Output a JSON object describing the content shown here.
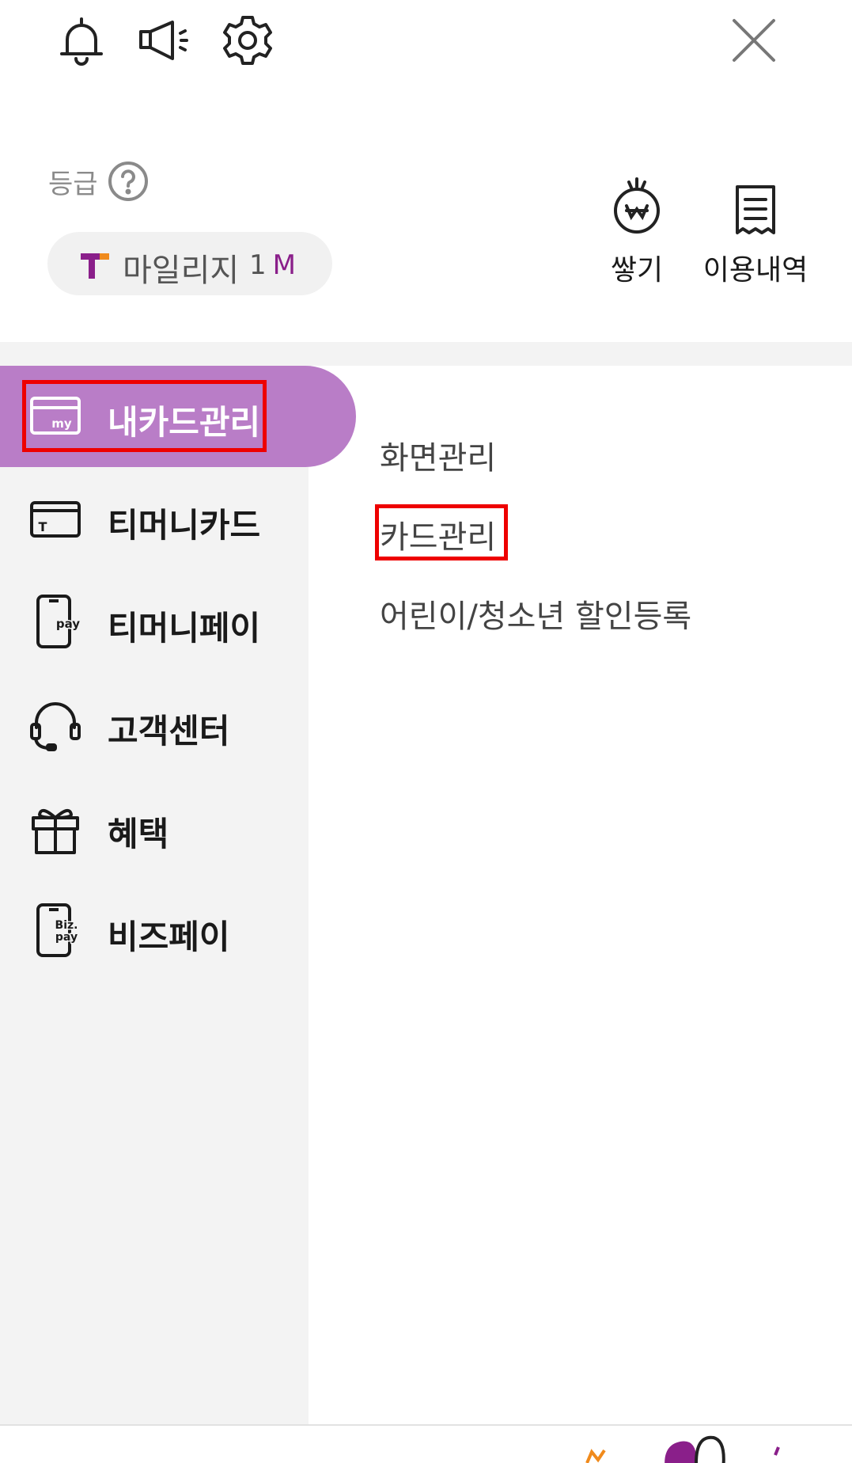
{
  "header": {
    "icons": [
      "bell-icon",
      "megaphone-icon",
      "gear-icon",
      "close-icon"
    ]
  },
  "grade": {
    "label": "등급",
    "help_icon": "question-circle-icon"
  },
  "mileage": {
    "name": "마일리지",
    "amount": "1",
    "unit": "M"
  },
  "quick_actions": [
    {
      "label": "쌓기",
      "icon": "coin-sprout-icon"
    },
    {
      "label": "이용내역",
      "icon": "receipt-icon"
    }
  ],
  "sidebar": {
    "items": [
      {
        "label": "내카드관리",
        "icon": "my-card-icon",
        "active": true
      },
      {
        "label": "티머니카드",
        "icon": "tmoney-card-icon",
        "active": false
      },
      {
        "label": "티머니페이",
        "icon": "pay-phone-icon",
        "active": false
      },
      {
        "label": "고객센터",
        "icon": "headset-icon",
        "active": false
      },
      {
        "label": "혜택",
        "icon": "gift-icon",
        "active": false
      },
      {
        "label": "비즈페이",
        "icon": "bizpay-phone-icon",
        "active": false
      }
    ]
  },
  "submenu": {
    "items": [
      {
        "label": "화면관리"
      },
      {
        "label": "카드관리"
      },
      {
        "label": "어린이/청소년 할인등록"
      }
    ]
  },
  "icon_text": {
    "my": "my",
    "t": "T",
    "pay": "pay",
    "biz": "Biz.",
    "bizpay": "pay"
  },
  "colors": {
    "accent_purple": "#b97dc7",
    "mileage_purple": "#8a1f8a",
    "brand_orange": "#f08a1c",
    "highlight_red": "#ee0000",
    "sidebar_bg": "#f3f3f3"
  }
}
